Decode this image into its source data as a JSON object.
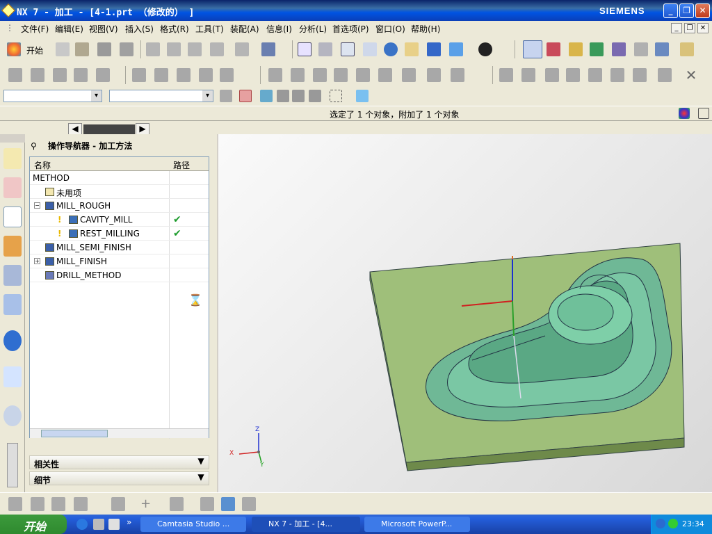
{
  "window": {
    "title": "NX 7 - 加工 - [4-1.prt （修改的） ]",
    "brand": "SIEMENS",
    "min": "_",
    "max": "❐",
    "close": "✕"
  },
  "menu": {
    "items": [
      "文件(F)",
      "编辑(E)",
      "视图(V)",
      "插入(S)",
      "格式(R)",
      "工具(T)",
      "装配(A)",
      "信息(I)",
      "分析(L)",
      "首选项(P)",
      "窗口(O)",
      "帮助(H)"
    ]
  },
  "toolbar": {
    "start_label": "开始",
    "icons": [
      "new-icon",
      "open-icon",
      "save-icon",
      "print-icon",
      "cut-icon",
      "copy-icon",
      "paste-icon",
      "delete-icon",
      "undo-icon",
      "fit-icon",
      "zoom-icon",
      "rotate-icon",
      "pan-icon",
      "shaded-icon"
    ]
  },
  "status": {
    "message": "选定了 1 个对象，附加了 1 个对象"
  },
  "navigator": {
    "title": "操作导航器 - 加工方法",
    "col_name": "名称",
    "col_path": "路径",
    "rows": [
      {
        "label": "METHOD",
        "indent": 0
      },
      {
        "label": "未用项",
        "indent": 1
      },
      {
        "label": "MILL_ROUGH",
        "indent": 1
      },
      {
        "label": "CAVITY_MILL",
        "indent": 2,
        "check": "✔"
      },
      {
        "label": "REST_MILLING",
        "indent": 2,
        "check": "✔"
      },
      {
        "label": "MILL_SEMI_FINISH",
        "indent": 1
      },
      {
        "label": "MILL_FINISH",
        "indent": 1
      },
      {
        "label": "DRILL_METHOD",
        "indent": 1
      }
    ],
    "dependencies": "相关性",
    "details": "细节",
    "hourglass": "⌛"
  },
  "axis": {
    "x": "X",
    "y": "Y",
    "z": "Z"
  },
  "taskbar": {
    "start": "开始",
    "tasks": [
      "Camtasia Studio ...",
      "NX 7 - 加工 - [4...",
      "Microsoft PowerP..."
    ],
    "clock": "23:34"
  },
  "colors": {
    "part_green": "#6fb896",
    "plate_green": "#9fbf7a",
    "title_blue": "#0a246a"
  }
}
